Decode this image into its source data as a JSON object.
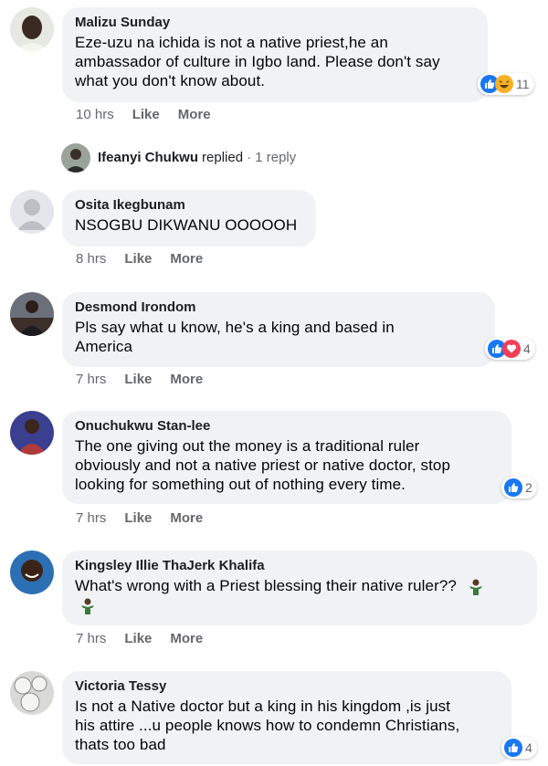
{
  "colors": {
    "bubble": "#f0f2f5",
    "like_blue": "#1877f2",
    "heart_red": "#f33e58",
    "haha_yellow": "#f7b125",
    "meta_gray": "#65676b"
  },
  "comments": [
    {
      "author": "Malizu Sunday",
      "text_lines": [
        "Eze-uzu na ichida is not a native priest,he an",
        "ambassador of culture in Igbo land. Please don't say",
        "what you don't know about."
      ],
      "time": "10 hrs",
      "like": "Like",
      "more": "More",
      "reactions": [
        "like-icon",
        "haha-icon"
      ],
      "reaction_count": "11",
      "avatar_icon": "user-photo-icon"
    },
    {
      "author": "Osita Ikegbunam",
      "text_lines": [
        "NSOGBU DIKWANU OOOOOH"
      ],
      "time": "8 hrs",
      "like": "Like",
      "more": "More",
      "avatar_icon": "default-avatar-icon"
    },
    {
      "author": "Desmond Irondom",
      "text_lines": [
        "Pls say what u know, he's a king and based in",
        "America"
      ],
      "time": "7 hrs",
      "like": "Like",
      "more": "More",
      "reactions": [
        "like-icon",
        "love-icon"
      ],
      "reaction_count": "4",
      "avatar_icon": "user-photo-icon"
    },
    {
      "author": "Onuchukwu Stan-lee",
      "text_lines": [
        "The one giving out the money is a traditional ruler",
        "obviously and not a native priest or native doctor, stop",
        "looking for something out of nothing every time."
      ],
      "time": "7 hrs",
      "like": "Like",
      "more": "More",
      "reactions": [
        "like-icon"
      ],
      "reaction_count": "2",
      "avatar_icon": "user-photo-icon"
    },
    {
      "author": "Kingsley Illie ThaJerk Khalifa",
      "text_lines": [
        "What's wrong with a Priest blessing their native ruler??"
      ],
      "time": "7 hrs",
      "like": "Like",
      "more": "More",
      "avatar_icon": "user-photo-icon"
    },
    {
      "author": "Victoria Tessy",
      "text_lines": [
        "Is not a Native doctor but a king in his kingdom ,is just",
        "his attire ...u people knows how to condemn Christians,",
        "thats too bad"
      ],
      "reactions": [
        "like-icon"
      ],
      "reaction_count": "4",
      "avatar_icon": "user-photo-icon"
    }
  ],
  "reply": {
    "name": "Ifeanyi Chukwu",
    "verb": "replied",
    "count": "· 1 reply"
  }
}
